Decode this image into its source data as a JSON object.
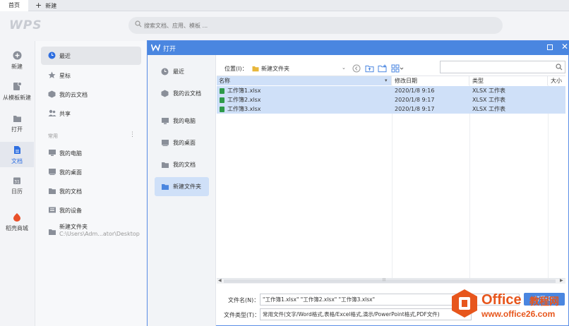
{
  "tabs": {
    "home": "首页",
    "new": "新建"
  },
  "header": {
    "logo": "WPS",
    "search_placeholder": "搜索文档、应用、模板 ..."
  },
  "rail": [
    {
      "label": "新建",
      "icon": "plus-circle-icon"
    },
    {
      "label": "从模板新建",
      "icon": "template-icon"
    },
    {
      "label": "打开",
      "icon": "folder-open-icon"
    },
    {
      "label": "文档",
      "icon": "document-icon",
      "active": true
    },
    {
      "label": "日历",
      "icon": "calendar-icon"
    },
    {
      "label": "稻壳商城",
      "icon": "store-icon"
    }
  ],
  "nav": {
    "items": [
      {
        "label": "最近",
        "icon": "clock-icon",
        "active": true
      },
      {
        "label": "星标",
        "icon": "star-icon"
      },
      {
        "label": "我的云文档",
        "icon": "cloud-icon"
      },
      {
        "label": "共享",
        "icon": "share-icon"
      }
    ],
    "section": "常用",
    "more": "⋮",
    "common": [
      {
        "label": "我的电脑",
        "icon": "computer-icon"
      },
      {
        "label": "我的桌面",
        "icon": "desktop-icon"
      },
      {
        "label": "我的文档",
        "icon": "folder-icon"
      },
      {
        "label": "我的设备",
        "icon": "device-icon"
      },
      {
        "label": "新建文件夹",
        "icon": "folder-icon",
        "sub": "C:\\Users\\Adm...ator\\Desktop"
      }
    ]
  },
  "dialog": {
    "title": "打开",
    "places": [
      {
        "label": "最近",
        "icon": "clock-icon"
      },
      {
        "label": "我的云文档",
        "icon": "cloud-icon"
      },
      {
        "label": "我的电脑",
        "icon": "computer-icon"
      },
      {
        "label": "我的桌面",
        "icon": "desktop-icon"
      },
      {
        "label": "我的文档",
        "icon": "folder-icon"
      },
      {
        "label": "新建文件夹",
        "icon": "folder-icon",
        "active": true
      }
    ],
    "location_label": "位置(I)：",
    "location_value": "新建文件夹",
    "columns": {
      "name": "名称",
      "modified": "修改日期",
      "type": "类型",
      "size": "大小"
    },
    "files": [
      {
        "name": "工作簿1.xlsx",
        "modified": "2020/1/8 9:16",
        "type": "XLSX 工作表"
      },
      {
        "name": "工作簿2.xlsx",
        "modified": "2020/1/8 9:17",
        "type": "XLSX 工作表"
      },
      {
        "name": "工作簿3.xlsx",
        "modified": "2020/1/8 9:17",
        "type": "XLSX 工作表"
      }
    ],
    "filename_label": "文件名(N)：",
    "filename_value": "\"工作簿1.xlsx\" \"工作簿2.xlsx\" \"工作簿3.xlsx\"",
    "filetype_label": "文件类型(T)：",
    "filetype_value": "常用文件(文字/Word格式,表格/Excel格式,演示/PowerPoint格式,PDF文件)",
    "open_label": "打开(O)",
    "scroll_mid": "⦙⦙⦙"
  },
  "watermark": {
    "brand": "Office",
    "brand2": "教程网",
    "url": "www.office26.com"
  },
  "colors": {
    "accent": "#4a86e0",
    "selection": "#cfe0f8",
    "excel_green": "#2e9a4a",
    "watermark": "#e7561c"
  }
}
